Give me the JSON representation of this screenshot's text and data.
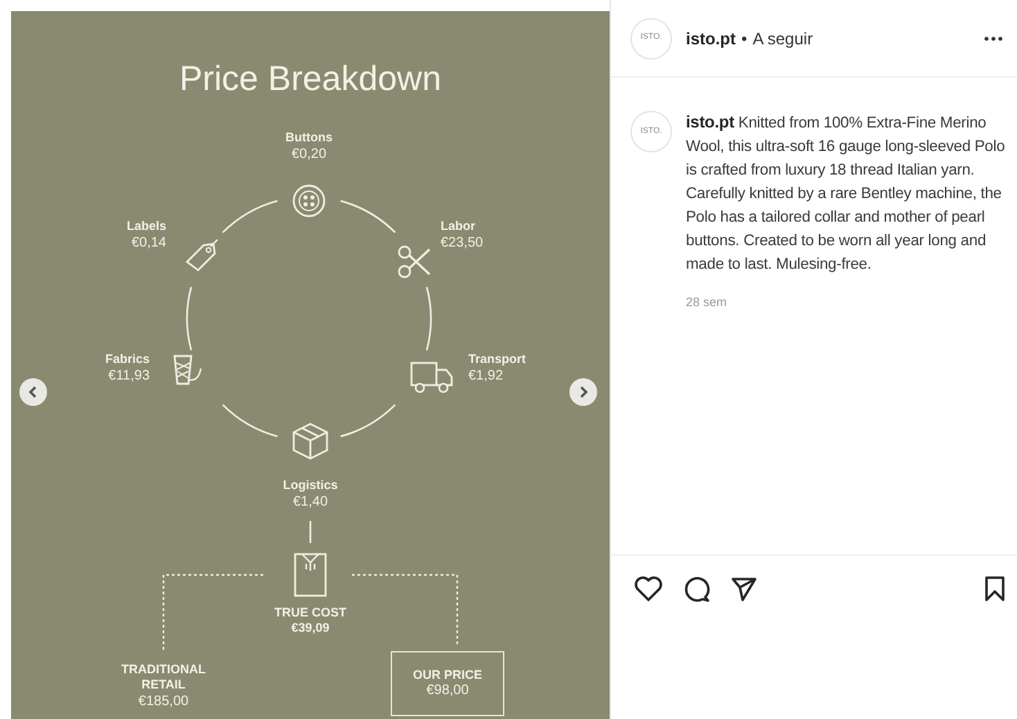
{
  "post_image": {
    "title": "Price Breakdown",
    "nodes": [
      {
        "kind": "buttons",
        "label": "Buttons",
        "price": "€0,20"
      },
      {
        "kind": "labels",
        "label": "Labels",
        "price": "€0,14"
      },
      {
        "kind": "labor",
        "label": "Labor",
        "price": "€23,50"
      },
      {
        "kind": "fabrics",
        "label": "Fabrics",
        "price": "€11,93"
      },
      {
        "kind": "transport",
        "label": "Transport",
        "price": "€1,92"
      },
      {
        "kind": "logistics",
        "label": "Logistics",
        "price": "€1,40"
      }
    ],
    "true_cost": {
      "label": "TRUE COST",
      "price": "€39,09"
    },
    "traditional_retail": {
      "label": "TRADITIONAL RETAIL",
      "price": "€185,00"
    },
    "our_price": {
      "label": "OUR PRICE",
      "price": "€98,00"
    }
  },
  "post_header": {
    "avatar": "ISTO.",
    "account": "isto.pt",
    "separator": "•",
    "follow": "A seguir"
  },
  "caption": {
    "avatar": "ISTO.",
    "account": "isto.pt",
    "text": "Knitted from 100% Extra-Fine Merino Wool, this ultra-soft 16 gauge long-sleeved Polo is crafted from luxury 18 thread Italian yarn. Carefully knitted by a rare Bentley machine, the Polo has a tailored collar and mother of pearl buttons. Created to be worn all year long and made to last. Mulesing-free.",
    "time": "28 sem"
  }
}
